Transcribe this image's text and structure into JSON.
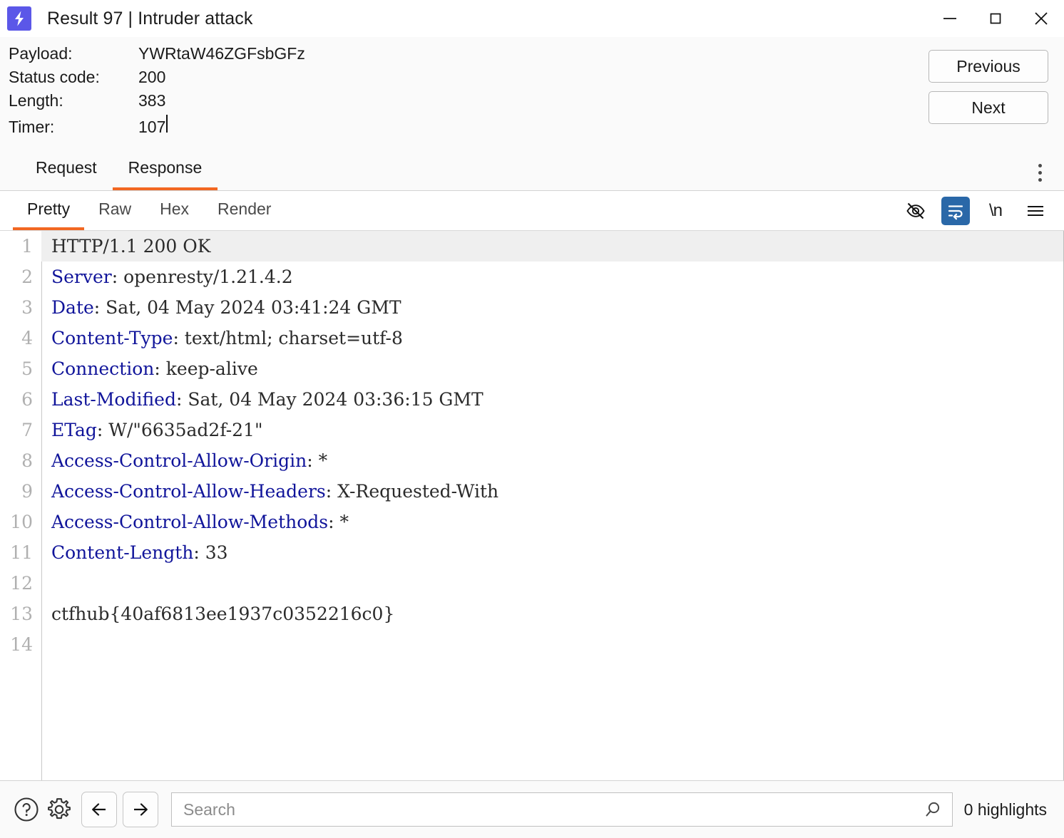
{
  "window": {
    "title": "Result 97 | Intruder attack",
    "logo_icon": "lightning-bolt-icon",
    "logo_color": "#5b57e8",
    "controls": {
      "minimize": "minimize-icon",
      "maximize": "maximize-icon",
      "close": "close-icon"
    }
  },
  "info": {
    "rows": [
      {
        "label": "Payload:",
        "value": "YWRtaW46ZGFsbGFz"
      },
      {
        "label": "Status code:",
        "value": "200"
      },
      {
        "label": "Length:",
        "value": "383"
      },
      {
        "label": "Timer:",
        "value": "107"
      }
    ],
    "previous_label": "Previous",
    "next_label": "Next"
  },
  "message_tabs": {
    "items": [
      {
        "label": "Request",
        "active": false
      },
      {
        "label": "Response",
        "active": true
      }
    ],
    "overflow_icon": "kebab-menu-icon"
  },
  "view_tabs": {
    "items": [
      {
        "label": "Pretty",
        "active": true
      },
      {
        "label": "Raw",
        "active": false
      },
      {
        "label": "Hex",
        "active": false
      },
      {
        "label": "Render",
        "active": false
      }
    ],
    "icons": [
      {
        "name": "eye-off-icon",
        "selected": false
      },
      {
        "name": "word-wrap-icon",
        "selected": true
      },
      {
        "name": "newline-icon",
        "label": "\\n",
        "selected": false
      },
      {
        "name": "hamburger-menu-icon",
        "selected": false
      }
    ],
    "accent_color": "#f26722",
    "selected_icon_bg": "#2a68a8"
  },
  "editor": {
    "highlighted_line": 1,
    "header_key_color": "#10149a",
    "lines": [
      {
        "n": "1",
        "key": "",
        "rest": "HTTP/1.1 200 OK"
      },
      {
        "n": "2",
        "key": "Server",
        "rest": ": openresty/1.21.4.2"
      },
      {
        "n": "3",
        "key": "Date",
        "rest": ": Sat, 04 May 2024 03:41:24 GMT"
      },
      {
        "n": "4",
        "key": "Content-Type",
        "rest": ": text/html; charset=utf-8"
      },
      {
        "n": "5",
        "key": "Connection",
        "rest": ": keep-alive"
      },
      {
        "n": "6",
        "key": "Last-Modified",
        "rest": ": Sat, 04 May 2024 03:36:15 GMT"
      },
      {
        "n": "7",
        "key": "ETag",
        "rest": ": W/\"6635ad2f-21\""
      },
      {
        "n": "8",
        "key": "Access-Control-Allow-Origin",
        "rest": ": *"
      },
      {
        "n": "9",
        "key": "Access-Control-Allow-Headers",
        "rest": ": X-Requested-With"
      },
      {
        "n": "10",
        "key": "Access-Control-Allow-Methods",
        "rest": ": *"
      },
      {
        "n": "11",
        "key": "Content-Length",
        "rest": ": 33"
      },
      {
        "n": "12",
        "key": "",
        "rest": ""
      },
      {
        "n": "13",
        "key": "",
        "rest": "ctfhub{40af6813ee1937c0352216c0}"
      },
      {
        "n": "14",
        "key": "",
        "rest": ""
      }
    ]
  },
  "bottom": {
    "help_icon": "help-circle-icon",
    "settings_icon": "gear-icon",
    "back_icon": "arrow-left-icon",
    "forward_icon": "arrow-right-icon",
    "search_placeholder": "Search",
    "search_value": "",
    "search_icon": "magnifier-icon",
    "highlights_label": "0 highlights"
  }
}
